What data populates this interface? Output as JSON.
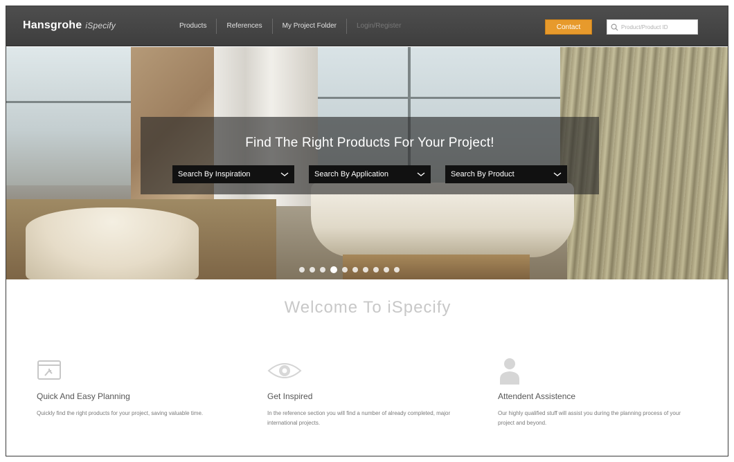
{
  "header": {
    "brand": "Hansgrohe",
    "brand_sub": "iSpecify",
    "nav": [
      "Products",
      "References",
      "My Project Folder",
      "Login/Register"
    ],
    "contact_label": "Contact",
    "search_placeholder": "Product/Product ID"
  },
  "hero": {
    "title": "Find The Right Products For Your Project!",
    "dropdowns": [
      "Search By Inspiration",
      "Search By Application",
      "Search By Product"
    ],
    "slide_count": 10,
    "active_slide": 4
  },
  "welcome": {
    "title": "Welcome To iSpecify",
    "features": [
      {
        "icon": "planning-icon",
        "title": "Quick And Easy Planning",
        "text": "Quickly find the right products for your project, saving valuable time."
      },
      {
        "icon": "eye-icon",
        "title": "Get Inspired",
        "text": "In the reference section you will find a number of already completed, major international projects."
      },
      {
        "icon": "person-icon",
        "title": "Attendent Assistence",
        "text": "Our highly qualified stuff will assist you during the planning process of your project and beyond."
      }
    ]
  },
  "colors": {
    "topbar": "#444444",
    "accent": "#e79a2c",
    "overlay": "#282828"
  }
}
